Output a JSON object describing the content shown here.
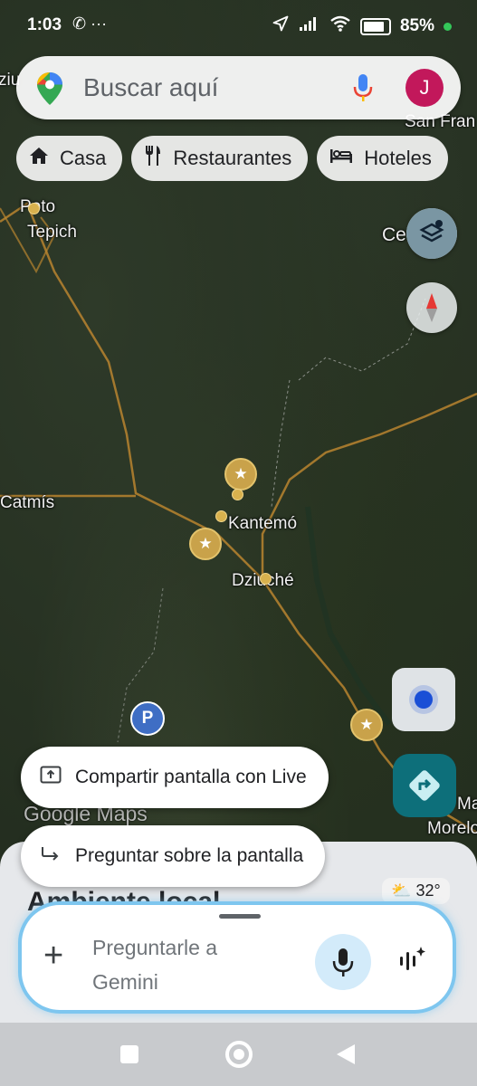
{
  "status_bar": {
    "time": "1:03",
    "left_icons": "✆ ···",
    "battery_percent": "85%"
  },
  "search": {
    "placeholder": "Buscar aquí",
    "avatar_initial": "J"
  },
  "chips": [
    {
      "label": "Casa",
      "icon": "home-icon"
    },
    {
      "label": "Restaurantes",
      "icon": "restaurant-icon"
    },
    {
      "label": "Hoteles",
      "icon": "hotel-icon"
    }
  ],
  "map": {
    "labels": {
      "poto": "Poto",
      "tepich": "Tepich",
      "catmis": "Catmís",
      "kantemo": "Kantemó",
      "dziuche": "Dziuché",
      "san_fran": "San Fran",
      "ce_yo": "Ce Yo",
      "dziu_top": "ziu",
      "ma": "Ma",
      "morelo": "Morelo"
    },
    "watermark": "Google Maps"
  },
  "popups": {
    "share_live": "Compartir pantalla con Live",
    "ask_screen": "Preguntar sobre la pantalla"
  },
  "bottom_sheet": {
    "title": "Ambiente local",
    "weather": "32°"
  },
  "gemini": {
    "prompt_placeholder": "Preguntarle a Gemini"
  },
  "colors": {
    "accent_blue": "#1a4fd6",
    "direction_teal": "#0d6f7a",
    "gemini_border": "#7ec6ef",
    "avatar_pink": "#c2185b"
  }
}
